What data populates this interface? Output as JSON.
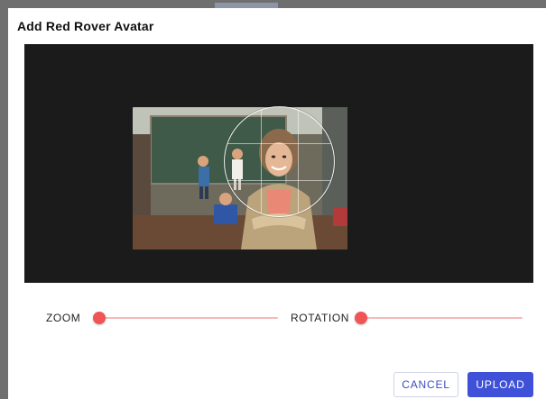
{
  "dialog": {
    "title": "Add Red Rover Avatar"
  },
  "sliders": {
    "zoom": {
      "label": "ZOOM",
      "value": 0.0
    },
    "rotation": {
      "label": "ROTATION",
      "value": 0.0
    }
  },
  "actions": {
    "cancel_label": "CANCEL",
    "upload_label": "UPLOAD"
  },
  "colors": {
    "accent": "#3f51d8",
    "slider": "#f05454",
    "cropper_bg": "#1b1b1b"
  }
}
